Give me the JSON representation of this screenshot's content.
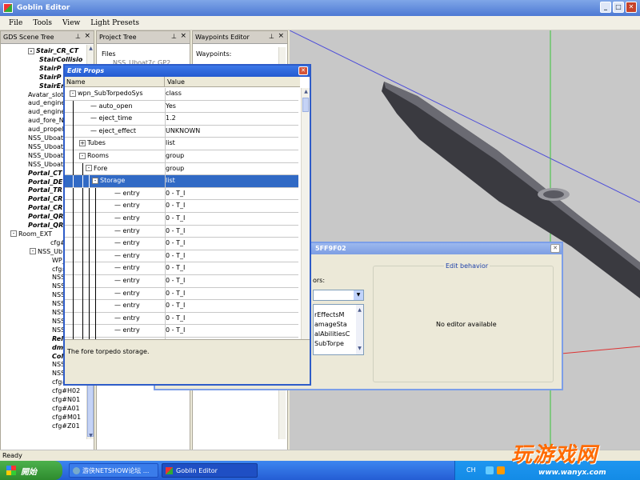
{
  "window": {
    "title": "Goblin Editor"
  },
  "menu": [
    "File",
    "Tools",
    "View",
    "Light Presets"
  ],
  "panes": {
    "scene_tree": {
      "title": "GDS Scene Tree",
      "items": [
        {
          "label": "Stair_CR_CT",
          "indent": 1,
          "style": "bi",
          "exp": "-"
        },
        {
          "label": "StairCollisio",
          "indent": 2,
          "style": "bi"
        },
        {
          "label": "StairP",
          "indent": 2,
          "style": "bi"
        },
        {
          "label": "StairP",
          "indent": 2,
          "style": "bi"
        },
        {
          "label": "StairEn",
          "indent": 2,
          "style": "bi"
        },
        {
          "label": "Avatar_slot",
          "indent": 0,
          "style": ""
        },
        {
          "label": "aud_engine",
          "indent": 0,
          "style": ""
        },
        {
          "label": "aud_engine",
          "indent": 0,
          "style": ""
        },
        {
          "label": "aud_fore_N",
          "indent": 0,
          "style": ""
        },
        {
          "label": "aud_propell",
          "indent": 0,
          "style": ""
        },
        {
          "label": "NSS_Uboat",
          "indent": 0,
          "style": ""
        },
        {
          "label": "NSS_Uboat",
          "indent": 0,
          "style": ""
        },
        {
          "label": "NSS_Uboat",
          "indent": 0,
          "style": ""
        },
        {
          "label": "NSS_Uboat",
          "indent": 0,
          "style": ""
        },
        {
          "label": "Portal_CT",
          "indent": 0,
          "style": "bi"
        },
        {
          "label": "Portal_DE",
          "indent": 0,
          "style": "bi"
        },
        {
          "label": "Portal_TR",
          "indent": 0,
          "style": "bi"
        },
        {
          "label": "Portal_CR",
          "indent": 0,
          "style": "bi"
        },
        {
          "label": "Portal_CR",
          "indent": 0,
          "style": "bi"
        },
        {
          "label": "Portal_QR",
          "indent": 0,
          "style": "bi"
        },
        {
          "label": "Portal_QR",
          "indent": 0,
          "style": "bi"
        },
        {
          "label": "Room_EXT",
          "indent": 0,
          "style": "",
          "exp": "-",
          "x": 12
        },
        {
          "label": "cfg#TAR",
          "indent": 3,
          "style": ""
        },
        {
          "label": "NSS_Ub",
          "indent": 2,
          "style": "",
          "exp": "-",
          "x": 36
        },
        {
          "label": "WP_",
          "indent": 4,
          "style": ""
        },
        {
          "label": "cfg#",
          "indent": 4,
          "style": ""
        },
        {
          "label": "NSS",
          "indent": 4,
          "style": ""
        },
        {
          "label": "NSS",
          "indent": 4,
          "style": ""
        },
        {
          "label": "NSS",
          "indent": 4,
          "style": ""
        },
        {
          "label": "NSS",
          "indent": 4,
          "style": ""
        },
        {
          "label": "NSS",
          "indent": 4,
          "style": ""
        },
        {
          "label": "NSS",
          "indent": 4,
          "style": ""
        },
        {
          "label": "NSS",
          "indent": 4,
          "style": ""
        },
        {
          "label": "Rel",
          "indent": 4,
          "style": "bi"
        },
        {
          "label": "dm",
          "indent": 4,
          "style": "bi"
        },
        {
          "label": "Col",
          "indent": 4,
          "style": "bi"
        },
        {
          "label": "NSS",
          "indent": 4,
          "style": ""
        },
        {
          "label": "NSS_Uboa",
          "indent": 4,
          "style": ""
        },
        {
          "label": "cfg#H01",
          "indent": 4,
          "style": ""
        },
        {
          "label": "cfg#H02",
          "indent": 4,
          "style": ""
        },
        {
          "label": "cfg#N01",
          "indent": 4,
          "style": ""
        },
        {
          "label": "cfg#A01",
          "indent": 4,
          "style": ""
        },
        {
          "label": "cfg#M01",
          "indent": 4,
          "style": ""
        },
        {
          "label": "cfg#Z01",
          "indent": 4,
          "style": ""
        }
      ]
    },
    "project_tree": {
      "title": "Project Tree",
      "items": [
        "Files",
        "NSS_Uboat7c.GP2"
      ]
    },
    "waypoints": {
      "title": "Waypoints Editor",
      "label": "Waypoints:"
    }
  },
  "edit_props": {
    "title": "Edit Props",
    "col_name": "Name",
    "col_value": "Value",
    "rows": [
      {
        "name": "wpn_SubTorpedoSys",
        "value": "class",
        "level": 0,
        "exp": "-"
      },
      {
        "name": "auto_open",
        "value": "Yes",
        "level": 1
      },
      {
        "name": "eject_time",
        "value": "1.2",
        "level": 1
      },
      {
        "name": "eject_effect",
        "value": "UNKNOWN",
        "level": 1
      },
      {
        "name": "Tubes",
        "value": "list",
        "level": 1,
        "exp": "+"
      },
      {
        "name": "Rooms",
        "value": "group",
        "level": 1,
        "exp": "-"
      },
      {
        "name": "Fore",
        "value": "group",
        "level": 2,
        "exp": "-"
      },
      {
        "name": "Storage",
        "value": "list",
        "level": 3,
        "exp": "-",
        "selected": true
      },
      {
        "name": "entry",
        "value": "0 - T_I",
        "level": 4
      },
      {
        "name": "entry",
        "value": "0 - T_I",
        "level": 4
      },
      {
        "name": "entry",
        "value": "0 - T_I",
        "level": 4
      },
      {
        "name": "entry",
        "value": "0 - T_I",
        "level": 4
      },
      {
        "name": "entry",
        "value": "0 - T_I",
        "level": 4
      },
      {
        "name": "entry",
        "value": "0 - T_I",
        "level": 4
      },
      {
        "name": "entry",
        "value": "0 - T_I",
        "level": 4
      },
      {
        "name": "entry",
        "value": "0 - T_I",
        "level": 4
      },
      {
        "name": "entry",
        "value": "0 - T_I",
        "level": 4
      },
      {
        "name": "entry",
        "value": "0 - T_I",
        "level": 4
      },
      {
        "name": "entry",
        "value": "0 - T_I",
        "level": 4
      },
      {
        "name": "entry",
        "value": "0 - T_I",
        "level": 4
      },
      {
        "name": "entry",
        "value": "0 - T_I",
        "level": 4
      }
    ],
    "description": "The fore torpedo storage."
  },
  "behavior_dialog": {
    "title": "5FF9F02",
    "left_label": "ors:",
    "list_items": [
      "rEffectsM",
      "amageSta",
      "alAbilitiesC",
      "SubTorpe"
    ],
    "group_title": "Edit behavior",
    "no_editor": "No editor available",
    "bottom_left": "",
    "bottom_right": ""
  },
  "status": "Ready",
  "taskbar": {
    "start": "開始",
    "tasks": [
      "游侠NETSHOW论坛 ...",
      "Goblin Editor"
    ],
    "lang": "CH",
    "watermark_cn": "玩游戏网",
    "watermark_url": "www.wanyx.com"
  },
  "colors": {
    "selection": "#316ac5",
    "title_blue": "#245ad0",
    "viewport": "#c8c8c8",
    "submarine": "#3a3a40"
  }
}
